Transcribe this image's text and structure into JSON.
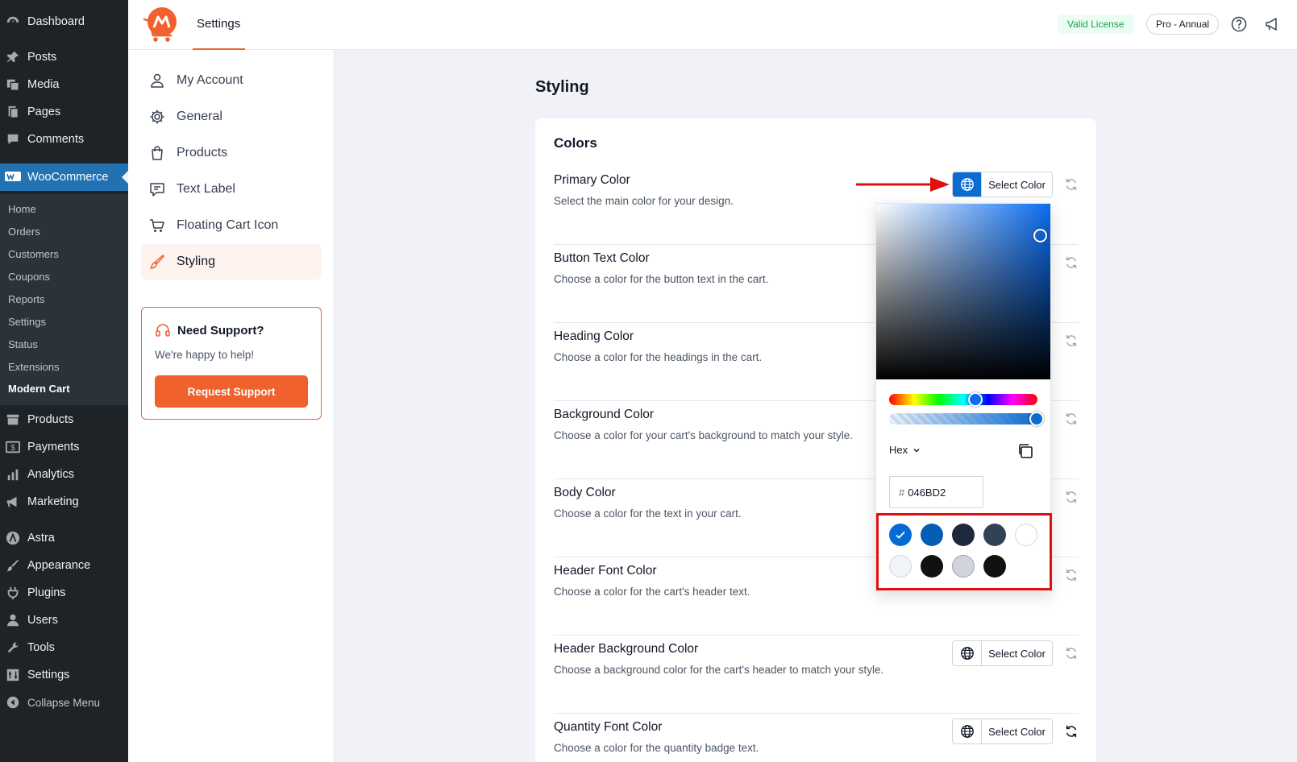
{
  "wp_menu": {
    "top": [
      {
        "label": "Dashboard",
        "icon": "dashboard-icon"
      },
      {
        "label": "Posts",
        "icon": "pin-icon"
      },
      {
        "label": "Media",
        "icon": "media-icon"
      },
      {
        "label": "Pages",
        "icon": "pages-icon"
      },
      {
        "label": "Comments",
        "icon": "comments-icon"
      }
    ],
    "woocommerce": {
      "label": "WooCommerce",
      "icon": "woocommerce-icon"
    },
    "woo_sub": [
      "Home",
      "Orders",
      "Customers",
      "Coupons",
      "Reports",
      "Settings",
      "Status",
      "Extensions",
      "Modern Cart"
    ],
    "bottom": [
      {
        "label": "Products",
        "icon": "archive-icon"
      },
      {
        "label": "Payments",
        "icon": "payments-icon"
      },
      {
        "label": "Analytics",
        "icon": "analytics-icon"
      },
      {
        "label": "Marketing",
        "icon": "megaphone-icon"
      },
      {
        "label": "Astra",
        "icon": "astra-icon"
      },
      {
        "label": "Appearance",
        "icon": "brush-icon"
      },
      {
        "label": "Plugins",
        "icon": "plug-icon"
      },
      {
        "label": "Users",
        "icon": "user-icon"
      },
      {
        "label": "Tools",
        "icon": "wrench-icon"
      },
      {
        "label": "Settings",
        "icon": "settings-icon"
      },
      {
        "label": "Collapse Menu",
        "icon": "collapse-icon"
      }
    ]
  },
  "header": {
    "title": "Settings",
    "license_badge": "Valid License",
    "plan_badge": "Pro - Annual"
  },
  "settings_nav": [
    {
      "label": "My Account",
      "icon": "user-icon"
    },
    {
      "label": "General",
      "icon": "gear-icon"
    },
    {
      "label": "Products",
      "icon": "bag-icon"
    },
    {
      "label": "Text Label",
      "icon": "message-icon"
    },
    {
      "label": "Floating Cart Icon",
      "icon": "cart-icon"
    },
    {
      "label": "Styling",
      "icon": "brush-icon",
      "active": true
    }
  ],
  "support": {
    "title": "Need Support?",
    "subtitle": "We're happy to help!",
    "button": "Request Support"
  },
  "main": {
    "page_title": "Styling",
    "section_title": "Colors",
    "select_label": "Select Color",
    "rows": [
      {
        "title": "Primary Color",
        "desc": "Select the main color for your design."
      },
      {
        "title": "Button Text Color",
        "desc": "Choose a color for the button text in the cart."
      },
      {
        "title": "Heading Color",
        "desc": "Choose a color for the headings in the cart."
      },
      {
        "title": "Background Color",
        "desc": "Choose a color for your cart's background to match your style."
      },
      {
        "title": "Body Color",
        "desc": "Choose a color for the text in your cart."
      },
      {
        "title": "Header Font Color",
        "desc": "Choose a color for the cart's header text."
      },
      {
        "title": "Header Background Color",
        "desc": "Choose a background color for the cart's header to match your style."
      },
      {
        "title": "Quantity Font Color",
        "desc": "Choose a color for the quantity badge text."
      }
    ]
  },
  "picker": {
    "format": "Hex",
    "hash": "#",
    "hex_value": "046BD2",
    "swatches": [
      "#046BD2",
      "#045CB4",
      "#1E293B",
      "#334155",
      "#FFFFFF",
      "#F0F5FA",
      "#111111",
      "#D1D5DB",
      "#111111"
    ],
    "selected_swatch": 0
  },
  "colors": {
    "accent": "#f0612d",
    "wp_blue": "#2271b1",
    "highlight_red": "#e01010"
  }
}
